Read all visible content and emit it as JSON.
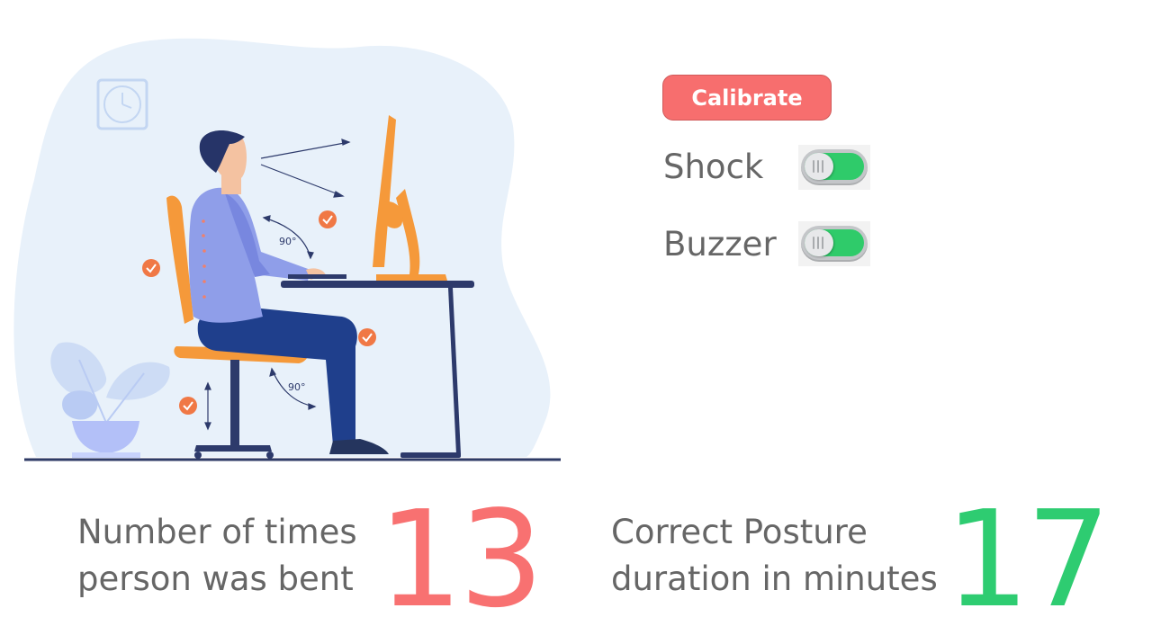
{
  "controls": {
    "calibrate_label": "Calibrate",
    "toggles": [
      {
        "label": "Shock",
        "on": true
      },
      {
        "label": "Buzzer",
        "on": true
      }
    ]
  },
  "illustration": {
    "angle_back": "90°",
    "angle_knee": "90°"
  },
  "stats": {
    "bent": {
      "label_line1": "Number of times",
      "label_line2": "person was bent",
      "value": "13",
      "color": "#f87171"
    },
    "posture": {
      "label_line1": "Correct Posture",
      "label_line2": "duration in minutes",
      "value": "17",
      "color": "#2ecc71"
    }
  }
}
